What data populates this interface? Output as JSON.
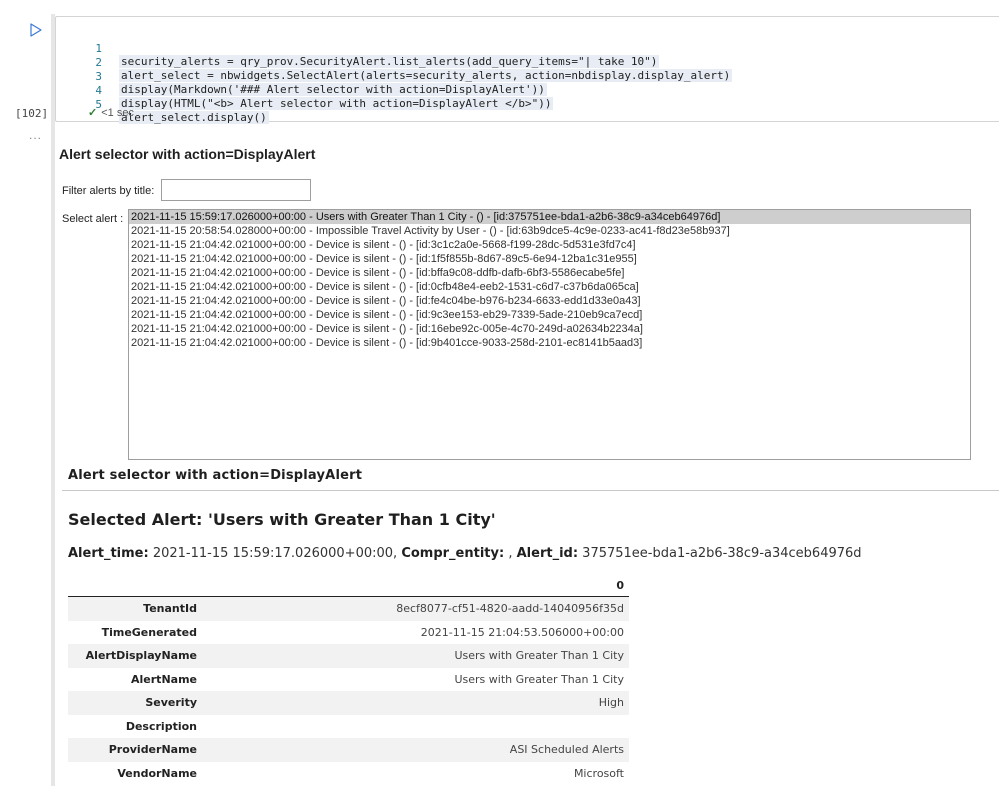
{
  "gutter": {
    "run_icon": "play-icon",
    "execution_count": "[102]",
    "collapsed_indicator": "..."
  },
  "code_cell": {
    "lines": [
      {
        "num": "1",
        "text": "security_alerts = qry_prov.SecurityAlert.list_alerts(add_query_items=\"| take 10\")"
      },
      {
        "num": "2",
        "text": "alert_select = nbwidgets.SelectAlert(alerts=security_alerts, action=nbdisplay.display_alert)"
      },
      {
        "num": "3",
        "text": "display(Markdown('### Alert selector with action=DisplayAlert'))"
      },
      {
        "num": "4",
        "text": "display(HTML(\"<b> Alert selector with action=DisplayAlert </b>\"))"
      },
      {
        "num": "5",
        "text": "alert_select.display()"
      }
    ],
    "status": {
      "icon": "checkmark-icon",
      "text": "<1 sec"
    }
  },
  "output": {
    "markdown_heading": "Alert selector with action=DisplayAlert",
    "filter": {
      "label": "Filter alerts by title:",
      "value": "",
      "placeholder": ""
    },
    "select": {
      "label": "Select alert :",
      "options": [
        "2021-11-15 15:59:17.026000+00:00 - Users with Greater Than 1 City - ()  - [id:375751ee-bda1-a2b6-38c9-a34ceb64976d]",
        "2021-11-15 20:58:54.028000+00:00 - Impossible Travel Activity by User - ()  - [id:63b9dce5-4c9e-0233-ac41-f8d23e58b937]",
        "2021-11-15 21:04:42.021000+00:00 - Device is silent - ()  - [id:3c1c2a0e-5668-f199-28dc-5d531e3fd7c4]",
        "2021-11-15 21:04:42.021000+00:00 - Device is silent - ()  - [id:1f5f855b-8d67-89c5-6e94-12ba1c31e955]",
        "2021-11-15 21:04:42.021000+00:00 - Device is silent - ()  - [id:bffa9c08-ddfb-dafb-6bf3-5586ecabe5fe]",
        "2021-11-15 21:04:42.021000+00:00 - Device is silent - ()  - [id:0cfb48e4-eeb2-1531-c6d7-c37b6da065ca]",
        "2021-11-15 21:04:42.021000+00:00 - Device is silent - ()  - [id:fe4c04be-b976-b234-6633-edd1d33e0a43]",
        "2021-11-15 21:04:42.021000+00:00 - Device is silent - ()  - [id:9c3ee153-eb29-7339-5ade-210eb9ca7ecd]",
        "2021-11-15 21:04:42.021000+00:00 - Device is silent - ()  - [id:16ebe92c-005e-4c70-249d-a02634b2234a]",
        "2021-11-15 21:04:42.021000+00:00 - Device is silent - ()  - [id:9b401cce-9033-258d-2101-ec8141b5aad3]"
      ],
      "selected_index": 0
    },
    "html_heading": "Alert selector with action=DisplayAlert",
    "selected_title": "Selected Alert: 'Users with Greater Than 1 City'",
    "summary": {
      "alert_time_label": "Alert_time:",
      "alert_time_value": "2021-11-15 15:59:17.026000+00:00,",
      "compr_entity_label": "Compr_entity:",
      "compr_entity_value": ",",
      "alert_id_label": "Alert_id:",
      "alert_id_value": "375751ee-bda1-a2b6-38c9-a34ceb64976d"
    },
    "table": {
      "column_header": "0",
      "rows": [
        {
          "key": "TenantId",
          "value": "8ecf8077-cf51-4820-aadd-14040956f35d"
        },
        {
          "key": "TimeGenerated",
          "value": "2021-11-15 21:04:53.506000+00:00"
        },
        {
          "key": "AlertDisplayName",
          "value": "Users with Greater Than 1 City"
        },
        {
          "key": "AlertName",
          "value": "Users with Greater Than 1 City"
        },
        {
          "key": "Severity",
          "value": "High"
        },
        {
          "key": "Description",
          "value": ""
        },
        {
          "key": "ProviderName",
          "value": "ASI Scheduled Alerts"
        },
        {
          "key": "VendorName",
          "value": "Microsoft"
        }
      ]
    }
  },
  "colors": {
    "line_number": "#237893",
    "string": "#a31515",
    "selected_option_bg": "#cecece",
    "table_stripe": "#f2f2f2"
  }
}
